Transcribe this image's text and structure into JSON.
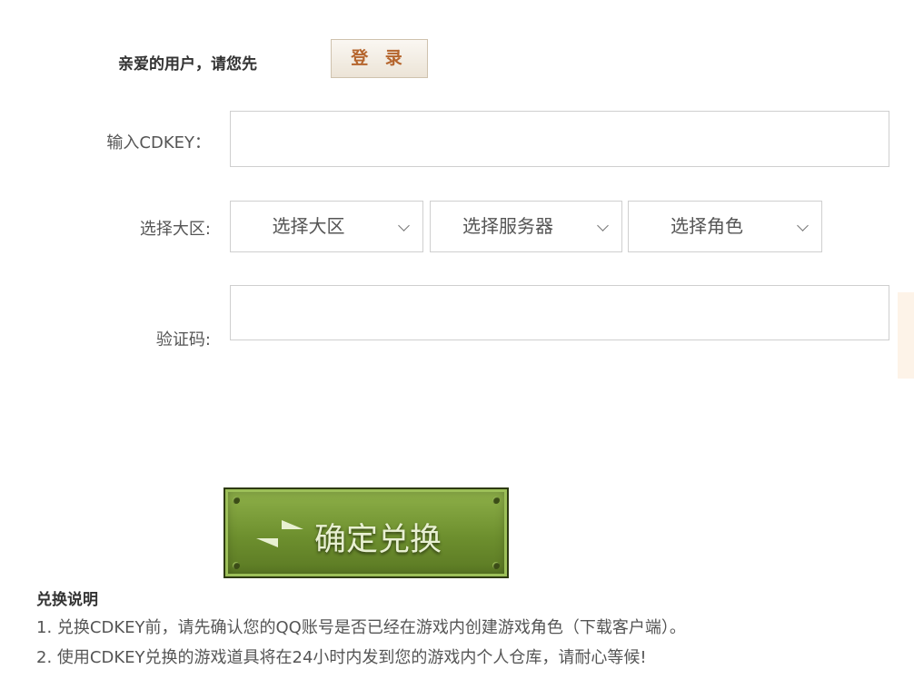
{
  "login": {
    "greeting": "亲爱的用户，请您先",
    "button_label": "登 录"
  },
  "cdkey": {
    "label": "输入CDKEY：",
    "value": "",
    "placeholder": ""
  },
  "region": {
    "label": "选择大区:",
    "selects": [
      {
        "value": "选择大区"
      },
      {
        "value": "选择服务器"
      },
      {
        "value": "选择角色"
      }
    ]
  },
  "captcha": {
    "label": "验证码:",
    "value": ""
  },
  "confirm": {
    "label": "确定兑换"
  },
  "notes": {
    "title": "兑换说明",
    "items": [
      "1. 兑换CDKEY前，请先确认您的QQ账号是否已经在游戏内创建游戏角色（下载客户端）。",
      "2. 使用CDKEY兑换的游戏道具将在24小时内发到您的游戏内个人仓库，请耐心等候!"
    ]
  },
  "colors": {
    "accent": "#b5652d",
    "button_green": "#6d8f2e",
    "border": "#cfcfcf"
  }
}
